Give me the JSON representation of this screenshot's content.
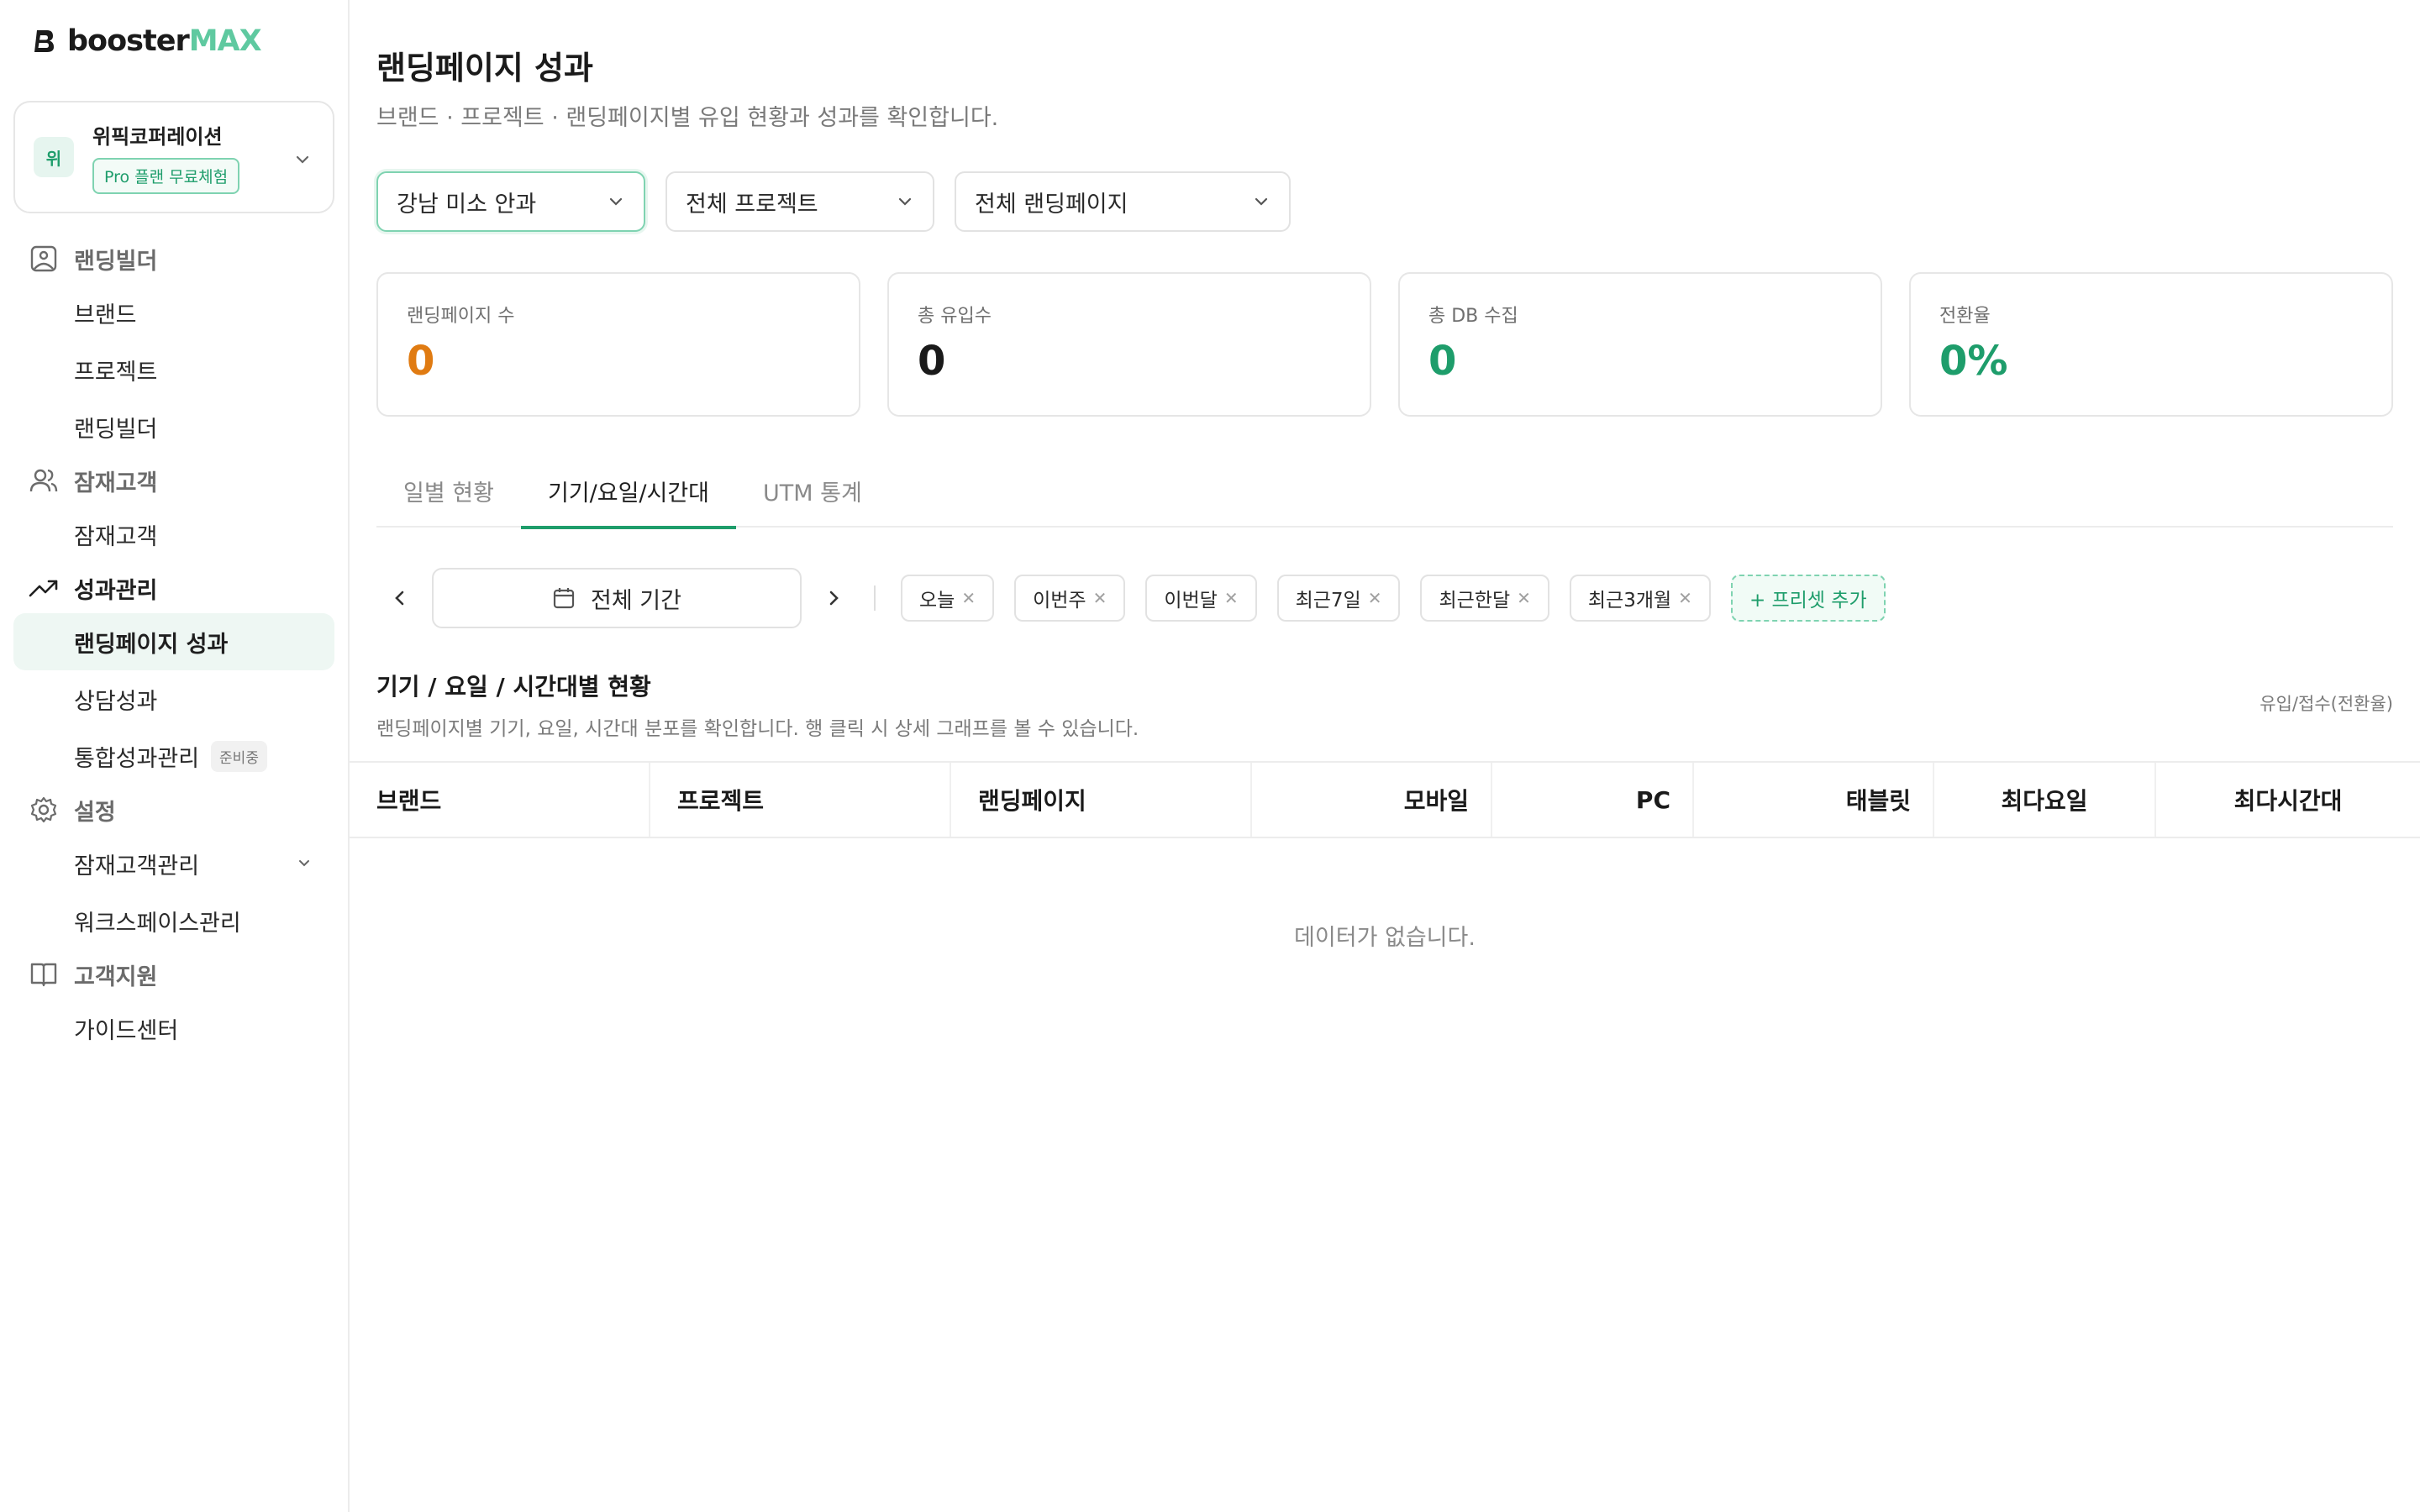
{
  "brand": {
    "name_part1": "booster",
    "name_part2": "MAX",
    "accent": "#5fc9a0"
  },
  "workspace": {
    "avatar": "위",
    "name": "위픽코퍼레이션",
    "plan": "Pro 플랜 무료체험"
  },
  "nav": {
    "group1": {
      "label": "랜딩빌더",
      "icon": "image-icon"
    },
    "items1": [
      "브랜드",
      "프로젝트",
      "랜딩빌더"
    ],
    "group2": {
      "label": "잠재고객",
      "icon": "users-icon"
    },
    "items2": [
      "잠재고객"
    ],
    "group3": {
      "label": "성과관리",
      "icon": "trend-icon"
    },
    "items3": [
      "랜딩페이지 성과",
      "상담성과",
      "통합성과관리"
    ],
    "items3_tag": "준비중",
    "group4": {
      "label": "설정",
      "icon": "gear-icon"
    },
    "items4": [
      "잠재고객관리",
      "워크스페이스관리"
    ],
    "group5": {
      "label": "고객지원",
      "icon": "book-icon"
    },
    "items5": [
      "가이드센터"
    ]
  },
  "page": {
    "title": "랜딩페이지 성과",
    "subtitle": "브랜드 · 프로젝트 · 랜딩페이지별 유입 현황과 성과를 확인합니다."
  },
  "filters": {
    "brand": "강남 미소 안과",
    "project": "전체 프로젝트",
    "landing": "전체 랜딩페이지"
  },
  "stats": [
    {
      "label": "랜딩페이지 수",
      "value": "0",
      "color": "#e07b12"
    },
    {
      "label": "총 유입수",
      "value": "0",
      "color": "#1a1a1a"
    },
    {
      "label": "총 DB 수집",
      "value": "0",
      "color": "#1e9d6b"
    },
    {
      "label": "전환율",
      "value": "0%",
      "color": "#1e9d6b"
    }
  ],
  "tabs": [
    "일별 현황",
    "기기/요일/시간대",
    "UTM 통계"
  ],
  "active_tab": "기기/요일/시간대",
  "period": {
    "label": "전체 기간",
    "presets": [
      "오늘",
      "이번주",
      "이번달",
      "최근7일",
      "최근한달",
      "최근3개월"
    ],
    "add_label": "+ 프리셋 추가"
  },
  "section": {
    "title": "기기 / 요일 / 시간대별 현황",
    "desc": "랜딩페이지별 기기, 요일, 시간대 분포를 확인합니다. 행 클릭 시 상세 그래프를 볼 수 있습니다.",
    "unit": "유입/접수(전환율)"
  },
  "table": {
    "columns": [
      "브랜드",
      "프로젝트",
      "랜딩페이지",
      "모바일",
      "PC",
      "태블릿",
      "최다요일",
      "최다시간대"
    ],
    "empty": "데이터가 없습니다."
  }
}
